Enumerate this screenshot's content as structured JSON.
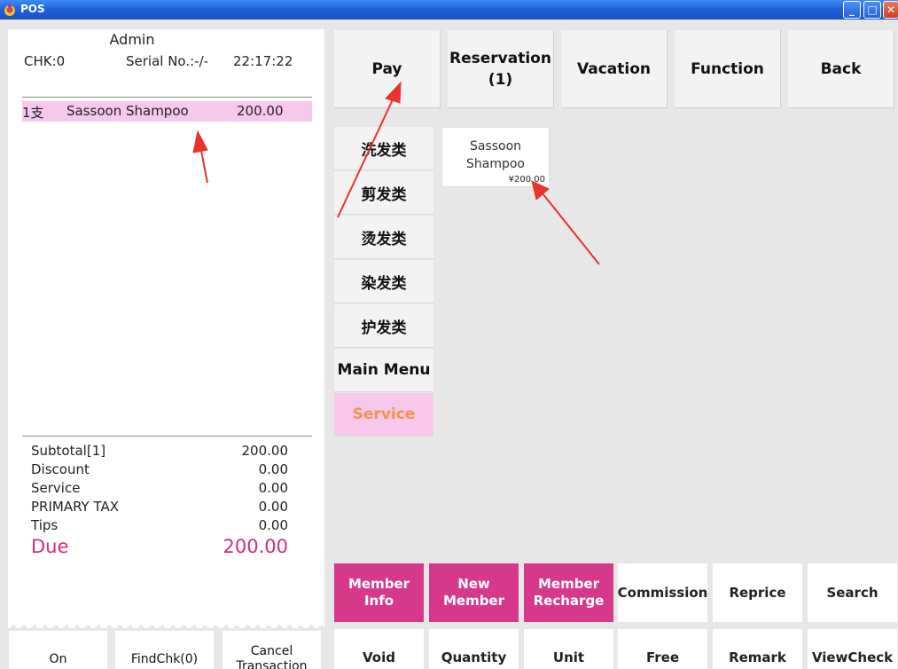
{
  "window": {
    "title": "POS"
  },
  "receipt": {
    "operator": "Admin",
    "chk": "CHK:0",
    "serial": "Serial No.:-/-",
    "time": "22:17:22",
    "items": [
      {
        "qty": "1支",
        "name": "Sassoon Shampoo",
        "price": "200.00"
      }
    ],
    "summary": [
      {
        "label": "Subtotal[1]",
        "value": "200.00"
      },
      {
        "label": "Discount",
        "value": "0.00"
      },
      {
        "label": "Service",
        "value": "0.00"
      },
      {
        "label": "PRIMARY TAX",
        "value": "0.00"
      },
      {
        "label": "Tips",
        "value": "0.00"
      }
    ],
    "due": {
      "label": "Due",
      "value": "200.00"
    }
  },
  "bottom_left_buttons": [
    "On",
    "FindChk(0)",
    "Cancel Transaction"
  ],
  "top_buttons": [
    "Pay",
    "Reservation\n(1)",
    "Vacation",
    "Function",
    "Back"
  ],
  "categories": [
    "洗发类",
    "剪发类",
    "烫发类",
    "染发类",
    "护发类",
    "Main Menu",
    "Service"
  ],
  "product": {
    "name": "Sassoon\nShampoo",
    "price": "¥200.00"
  },
  "function_buttons_row1": [
    "Member Info",
    "New\nMember",
    "Member\nRecharge",
    "Commission",
    "Reprice",
    "Search"
  ],
  "function_buttons_row2": [
    "Void",
    "Quantity",
    "Unit",
    "Free",
    "Remark",
    "ViewCheck"
  ],
  "colors": {
    "accent_pink": "#d6398a",
    "selected_row": "#f7c7ec",
    "due_text": "#d12b82",
    "service_text": "#f0974a",
    "arrow": "#e8342a"
  }
}
